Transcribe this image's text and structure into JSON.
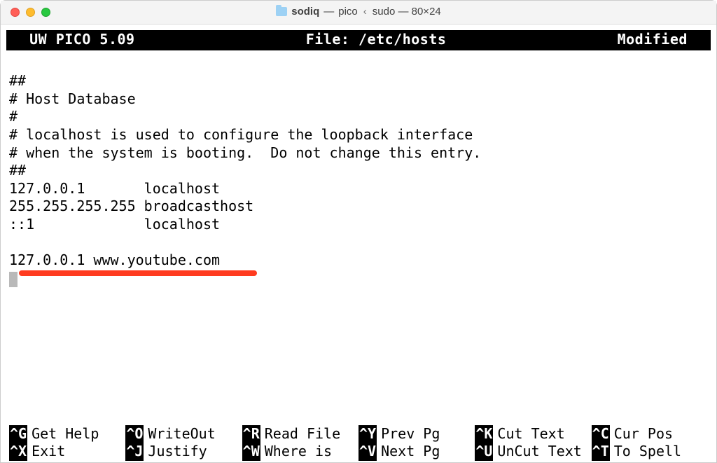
{
  "window": {
    "title_bold": "sodiq",
    "title_dash": "—",
    "title_mid": "pico",
    "title_sep": "‹",
    "title_end": "sudo — 80×24"
  },
  "header": {
    "left": "  UW PICO 5.09",
    "center": "File: /etc/hosts",
    "right": "Modified  "
  },
  "file_lines": [
    "##",
    "# Host Database",
    "#",
    "# localhost is used to configure the loopback interface",
    "# when the system is booting.  Do not change this entry.",
    "##",
    "127.0.0.1       localhost",
    "255.255.255.255 broadcasthost",
    "::1             localhost",
    "",
    "127.0.0.1 www.youtube.com"
  ],
  "shortcuts": {
    "row1": [
      {
        "key": "^G",
        "label": "Get Help"
      },
      {
        "key": "^O",
        "label": "WriteOut"
      },
      {
        "key": "^R",
        "label": "Read File"
      },
      {
        "key": "^Y",
        "label": "Prev Pg"
      },
      {
        "key": "^K",
        "label": "Cut Text"
      },
      {
        "key": "^C",
        "label": "Cur Pos"
      }
    ],
    "row2": [
      {
        "key": "^X",
        "label": "Exit"
      },
      {
        "key": "^J",
        "label": "Justify"
      },
      {
        "key": "^W",
        "label": "Where is"
      },
      {
        "key": "^V",
        "label": "Next Pg"
      },
      {
        "key": "^U",
        "label": "UnCut Text"
      },
      {
        "key": "^T",
        "label": "To Spell"
      }
    ]
  }
}
